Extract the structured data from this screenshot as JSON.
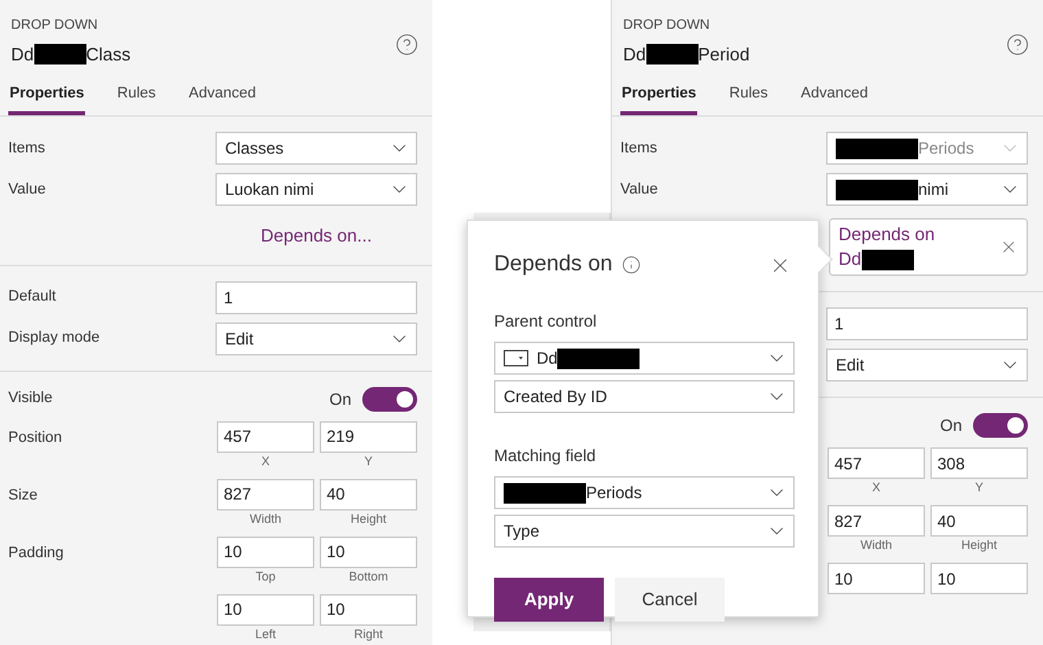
{
  "panels": [
    {
      "caption": "DROP DOWN",
      "title": [
        {
          "kind": "text",
          "text": "Dd"
        },
        {
          "kind": "redacted"
        },
        {
          "kind": "text",
          "text": "Class"
        }
      ],
      "tabs": [
        {
          "label": "Properties",
          "selected": true
        },
        {
          "label": "Rules",
          "selected": false
        },
        {
          "label": "Advanced",
          "selected": false
        }
      ],
      "sections": [
        [
          {
            "kind": "dropdown",
            "label": "Items",
            "value": [
              {
                "kind": "text",
                "text": "Classes"
              }
            ],
            "disabled": false
          },
          {
            "kind": "dropdown",
            "label": "Value",
            "value": [
              {
                "kind": "text",
                "text": "Luokan nimi"
              }
            ],
            "disabled": false
          },
          {
            "kind": "link",
            "text": "Depends on..."
          }
        ],
        [
          {
            "kind": "input",
            "label": "Default",
            "value": "1"
          },
          {
            "kind": "dropdown",
            "label": "Display mode",
            "value": [
              {
                "kind": "text",
                "text": "Edit"
              }
            ],
            "disabled": false
          }
        ],
        [
          {
            "kind": "toggle",
            "label": "Visible",
            "reading": "On",
            "on": true
          },
          {
            "kind": "pair",
            "label": "Position",
            "fields": [
              {
                "value": "457",
                "caption": "X"
              },
              {
                "value": "219",
                "caption": "Y"
              }
            ]
          },
          {
            "kind": "pair",
            "label": "Size",
            "fields": [
              {
                "value": "827",
                "caption": "Width"
              },
              {
                "value": "40",
                "caption": "Height"
              }
            ]
          },
          {
            "kind": "pair",
            "label": "Padding",
            "fields": [
              {
                "value": "10",
                "caption": "Top"
              },
              {
                "value": "10",
                "caption": "Bottom"
              }
            ]
          },
          {
            "kind": "pair",
            "fields": [
              {
                "value": "10",
                "caption": "Left"
              },
              {
                "value": "10",
                "caption": "Right"
              }
            ]
          }
        ]
      ]
    },
    {
      "caption": "DROP DOWN",
      "title": [
        {
          "kind": "text",
          "text": "Dd"
        },
        {
          "kind": "redacted"
        },
        {
          "kind": "text",
          "text": "Period"
        }
      ],
      "tabs": [
        {
          "label": "Properties",
          "selected": true
        },
        {
          "label": "Rules",
          "selected": false
        },
        {
          "label": "Advanced",
          "selected": false
        }
      ],
      "sections": [
        [
          {
            "kind": "dropdown",
            "label": "Items",
            "value": [
              {
                "kind": "redacted"
              },
              {
                "kind": "text",
                "text": "Periods"
              }
            ],
            "disabled": true
          },
          {
            "kind": "dropdown",
            "label": "Value",
            "value": [
              {
                "kind": "redacted"
              },
              {
                "kind": "text",
                "text": "nimi"
              }
            ],
            "disabled": false
          },
          {
            "kind": "dependency",
            "lines": [
              [
                {
                  "kind": "text",
                  "text": "Depends on"
                }
              ],
              [
                {
                  "kind": "text",
                  "text": "Dd"
                },
                {
                  "kind": "redacted"
                }
              ]
            ]
          }
        ],
        [
          {
            "kind": "input",
            "value": "1"
          },
          {
            "kind": "dropdown",
            "value": [
              {
                "kind": "text",
                "text": "Edit"
              }
            ],
            "disabled": false
          }
        ],
        [
          {
            "kind": "toggle",
            "reading": "On",
            "on": true
          },
          {
            "kind": "pair",
            "fields": [
              {
                "value": "457",
                "caption": "X"
              },
              {
                "value": "308",
                "caption": "Y"
              }
            ]
          },
          {
            "kind": "pair",
            "fields": [
              {
                "value": "827",
                "caption": "Width"
              },
              {
                "value": "40",
                "caption": "Height"
              }
            ]
          },
          {
            "kind": "pair",
            "fields": [
              {
                "value": "10"
              },
              {
                "value": "10"
              }
            ]
          }
        ]
      ]
    }
  ],
  "popup": {
    "title": "Depends on",
    "groups": [
      {
        "label": "Parent control",
        "dropdowns": [
          {
            "kind": "control",
            "value": [
              {
                "kind": "text",
                "text": "Dd"
              },
              {
                "kind": "redacted"
              }
            ]
          },
          {
            "kind": "plain",
            "value": [
              {
                "kind": "text",
                "text": "Created By ID"
              }
            ]
          }
        ]
      },
      {
        "label": "Matching field",
        "dropdowns": [
          {
            "kind": "plain",
            "value": [
              {
                "kind": "redacted"
              },
              {
                "kind": "text",
                "text": "Periods"
              }
            ]
          },
          {
            "kind": "plain",
            "value": [
              {
                "kind": "text",
                "text": "Type"
              }
            ]
          }
        ]
      }
    ],
    "buttons": [
      {
        "label": "Apply",
        "kind": "primary"
      },
      {
        "label": "Cancel",
        "kind": "secondary"
      }
    ]
  }
}
